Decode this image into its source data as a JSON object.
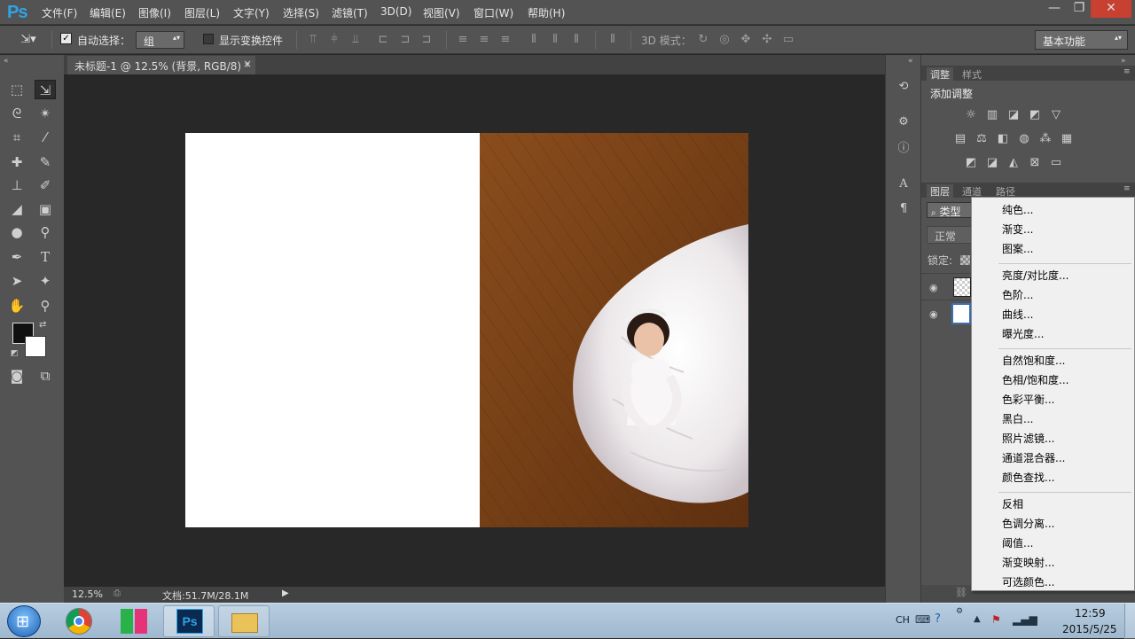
{
  "app": {
    "logo": "Ps"
  },
  "menu": [
    "文件(F)",
    "编辑(E)",
    "图像(I)",
    "图层(L)",
    "文字(Y)",
    "选择(S)",
    "滤镜(T)",
    "3D(D)",
    "视图(V)",
    "窗口(W)",
    "帮助(H)"
  ],
  "window_controls": {
    "minimize": "—",
    "restore": "❐",
    "close": "✕"
  },
  "options": {
    "auto_select_label": "自动选择：",
    "auto_select_value": "组",
    "show_transform_label": "显示变换控件",
    "mode_3d_label": "3D 模式：",
    "workspace": "基本功能"
  },
  "document": {
    "tab_title": "未标题-1 @ 12.5% (背景, RGB/8) *",
    "tab_close": "×",
    "zoom": "12.5%",
    "doc_info": "文档:51.7M/28.1M"
  },
  "panels": {
    "adjust_tab": "调整",
    "style_tab": "样式",
    "add_adjustment": "添加调整",
    "layers_tab": "图层",
    "channels_tab": "通道",
    "paths_tab": "路径",
    "kind_filter": "类型",
    "blend_mode": "正常",
    "lock_label": "锁定:"
  },
  "popup_menu": {
    "group1": [
      "纯色...",
      "渐变...",
      "图案..."
    ],
    "group2": [
      "亮度/对比度...",
      "色阶...",
      "曲线...",
      "曝光度..."
    ],
    "group3": [
      "自然饱和度...",
      "色相/饱和度...",
      "色彩平衡...",
      "黑白...",
      "照片滤镜...",
      "通道混合器...",
      "颜色查找..."
    ],
    "group4": [
      "反相",
      "色调分离...",
      "阈值...",
      "渐变映射...",
      "可选颜色..."
    ]
  },
  "taskbar": {
    "lang": "CH",
    "time": "12:59",
    "date": "2015/5/25"
  },
  "colors": {
    "chrome": "#535353",
    "workspace": "#282828",
    "ps_blue": "#2fa3e8",
    "floor": "#7a4318"
  }
}
